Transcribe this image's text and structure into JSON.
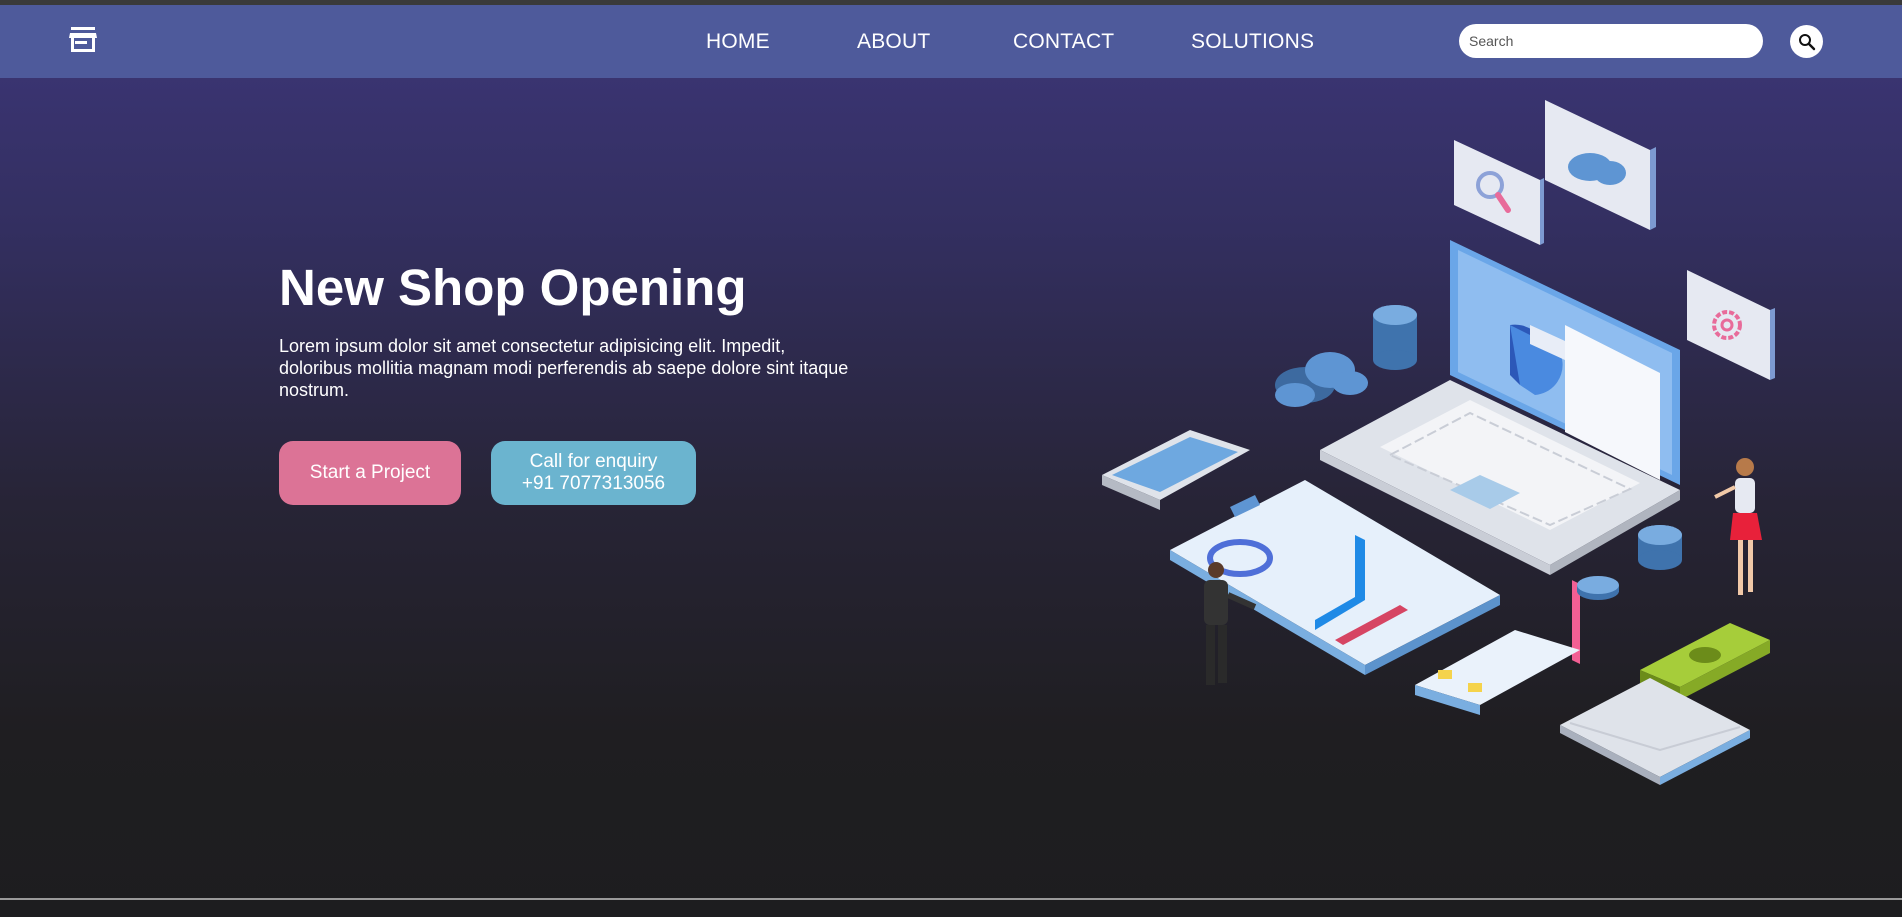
{
  "nav": {
    "logo_icon": "store-icon",
    "links": [
      "HOME",
      "ABOUT",
      "CONTACT",
      "SOLUTIONS"
    ],
    "search_placeholder": "Search",
    "search_icon": "search-icon"
  },
  "hero": {
    "title": "New Shop Opening",
    "text": "Lorem ipsum dolor sit amet consectetur adipisicing elit. Impedit, doloribus mollitia magnam modi perferendis ab saepe dolore sint itaque nostrum.",
    "start_button": "Start a Project",
    "call_button_line1": "Call for enquiry",
    "call_button_line2": "+91 7077313056"
  },
  "colors": {
    "navbar": "#4e5a9b",
    "start_button": "#dc7396",
    "call_button": "#6bb4cf"
  }
}
